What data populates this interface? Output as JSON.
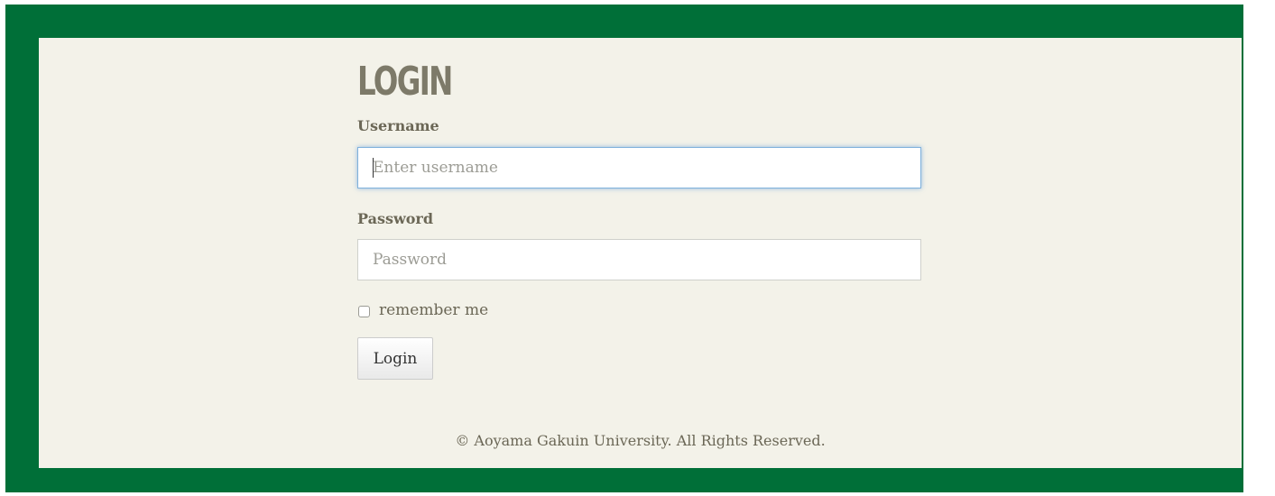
{
  "login": {
    "title": "LOGIN",
    "username_label": "Username",
    "username_placeholder": "Enter username",
    "username_value": "",
    "password_label": "Password",
    "password_placeholder": "Password",
    "password_value": "",
    "remember_label": "remember me",
    "remember_checked": false,
    "submit_label": "Login"
  },
  "footer": {
    "copyright": "© Aoyama Gakuin University. All Rights Reserved."
  },
  "colors": {
    "frame": "#006f38",
    "panel": "#f3f2e9",
    "title": "#7d7a69",
    "focus_border": "#7fb1dc"
  }
}
